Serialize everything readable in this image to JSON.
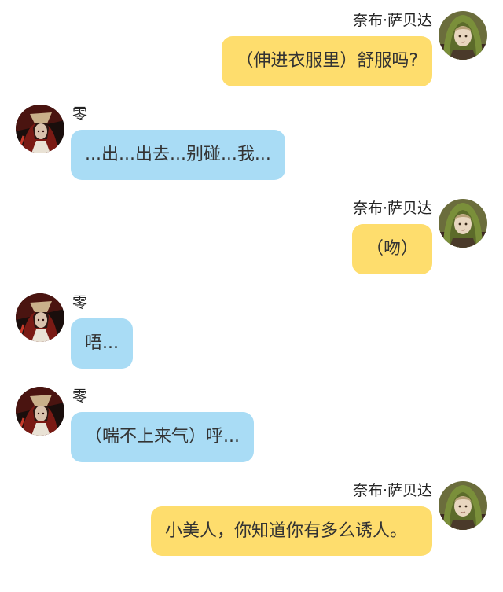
{
  "conversation": {
    "messages": [
      {
        "side": "right",
        "speaker": "奈布·萨贝达",
        "text": "（伸进衣服里）舒服吗?"
      },
      {
        "side": "left",
        "speaker": "零",
        "text": "...出...出去...别碰...我..."
      },
      {
        "side": "right",
        "speaker": "奈布·萨贝达",
        "text": "（吻）"
      },
      {
        "side": "left",
        "speaker": "零",
        "text": "唔..."
      },
      {
        "side": "left",
        "speaker": "零",
        "text": "（喘不上来气）呼..."
      },
      {
        "side": "right",
        "speaker": "奈布·萨贝达",
        "text": "小美人，你知道你有多么诱人。"
      }
    ]
  },
  "colors": {
    "right_bubble": "#fedd6d",
    "left_bubble": "#a9dcf5",
    "background": "#ffffff",
    "text": "#333333"
  },
  "icons": {
    "right_avatar": "green-hooded-character-avatar-icon",
    "left_avatar": "dark-red-character-avatar-icon"
  }
}
